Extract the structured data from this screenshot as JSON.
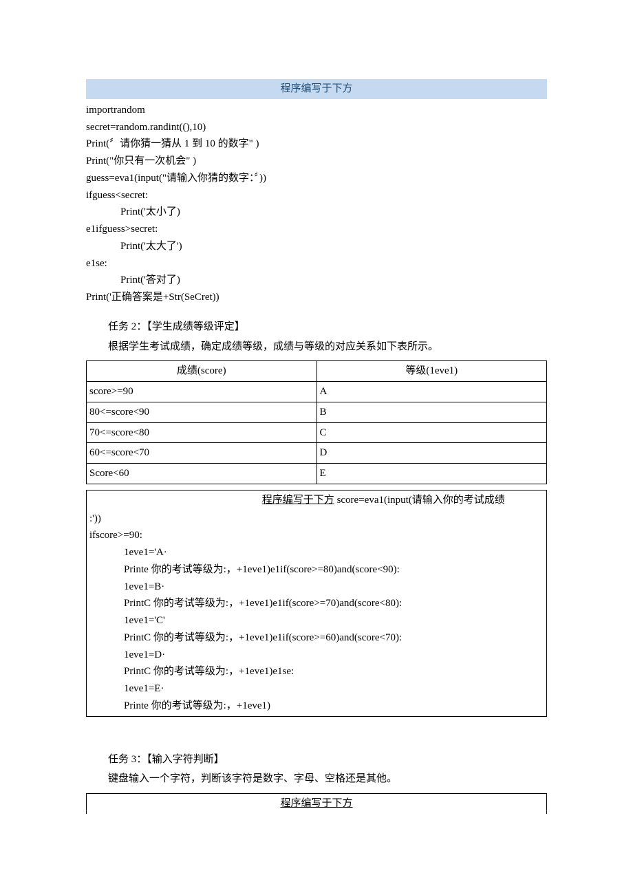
{
  "header1": "程序编写于下方",
  "code1": {
    "l1": "importrandom",
    "l2": "secret=random.randint((),10)",
    "l3": "Print(〞请你猜一猜从 1 到 10 的数字\" )",
    "l4": "Print(\"你只有一次机会\" )",
    "l5": "guess=eva1(input(\"请输入你猜的数字：〞))",
    "l6": "ifguess<secret:",
    "l7": "Print('太小了)",
    "l8": "e1ifguess>secret:",
    "l9": "Print('太大了')",
    "l10": "e1se:",
    "l11": "Print('答对了)",
    "l12": "Print('正确答案是+Str(SeCret))"
  },
  "task2": {
    "title": "任务 2：【学生成绩等级评定】",
    "desc": "根据学生考试成绩，确定成绩等级，成绩与等级的对应关系如下表所示。",
    "th1": "成绩(score)",
    "th2": "等级(1eve1)",
    "rows": [
      {
        "c1": "score>=90",
        "c2": "A"
      },
      {
        "c1": "80<=score<90",
        "c2": "B"
      },
      {
        "c1": "70<=score<80",
        "c2": "C"
      },
      {
        "c1": "60<=score<70",
        "c2": "D"
      },
      {
        "c1": "Score<60",
        "c2": "E"
      }
    ]
  },
  "box2": {
    "headerPrefix": "程序编写于下方",
    "headerSuffix": " score=eva1(input(请输入你的考试成绩",
    "l0": ":'))",
    "l1": "ifscore>=90:",
    "l2": "1eve1='A·",
    "l3": "Printe 你的考试等级为:，+1eve1)e1if(score>=80)and(score<90):",
    "l4": "1eve1=B·",
    "l5": "PrintC 你的考试等级为:，+1eve1)e1if(score>=70)and(score<80):",
    "l6": "1eve1='C'",
    "l7": "PrintC 你的考试等级为:，+1eve1)e1if(score>=60)and(score<70):",
    "l8": "1eve1=D·",
    "l9": "PrintC 你的考试等级为:，+1eve1)e1se:",
    "l10": "1eve1=E·",
    "l11": "Printe 你的考试等级为:，+1eve1)"
  },
  "task3": {
    "title": "任务 3：【输入字符判断】",
    "desc": "键盘输入一个字符，判断该字符是数字、字母、空格还是其他。",
    "header": "程序编写于下方"
  }
}
